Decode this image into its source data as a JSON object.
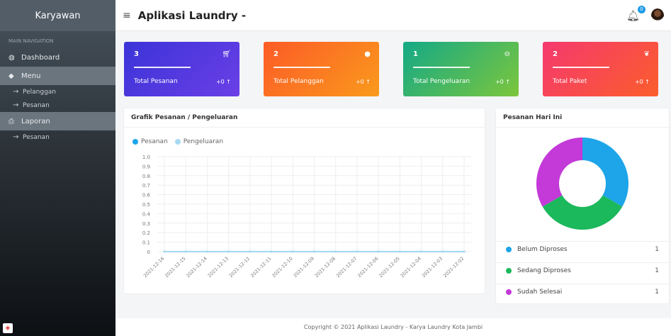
{
  "sidebar": {
    "brand": "Karyawan",
    "section": "MAIN NAVIGATION",
    "items": [
      {
        "label": "Dashboard"
      },
      {
        "label": "Menu"
      },
      {
        "label": "Pelanggan"
      },
      {
        "label": "Pesanan"
      },
      {
        "label": "Laporan"
      },
      {
        "label": "Pesanan"
      }
    ]
  },
  "header": {
    "menu_icon": "≡",
    "title": "Aplikasi Laundry -",
    "notif_count": "0"
  },
  "cards": [
    {
      "value": "3",
      "label": "Total Pesanan",
      "change": "+0 ↑",
      "icon": "cart-icon",
      "color": "#4f3fe0"
    },
    {
      "value": "2",
      "label": "Total Pelanggan",
      "change": "+0 ↑",
      "icon": "user-icon",
      "color": "#f77e21"
    },
    {
      "value": "1",
      "label": "Total Pengeluaran",
      "change": "+0 ↑",
      "icon": "arrow-circle-icon",
      "color": "#28b46b"
    },
    {
      "value": "2",
      "label": "Total Paket",
      "change": "+0 ↑",
      "icon": "leaf-icon",
      "color": "#f23d55"
    }
  ],
  "line_panel": {
    "title": "Grafik Pesanan / Pengeluaran"
  },
  "donut_panel": {
    "title": "Pesanan Hari Ini",
    "rows": [
      {
        "label": "Belum Diproses",
        "value": "1",
        "color": "#1ea5e9"
      },
      {
        "label": "Sedang Diproses",
        "value": "1",
        "color": "#1bb85c"
      },
      {
        "label": "Sudah Selesai",
        "value": "1",
        "color": "#c33ad8"
      }
    ]
  },
  "chart_data": [
    {
      "type": "line",
      "series": [
        {
          "name": "Pesanan",
          "values": [
            0,
            0,
            0,
            0,
            0,
            0,
            0,
            0,
            0,
            0,
            0,
            0,
            0,
            0,
            0
          ],
          "color": "#1ea5e9"
        },
        {
          "name": "Pengeluaran",
          "values": [
            0,
            0,
            0,
            0,
            0,
            0,
            0,
            0,
            0,
            0,
            0,
            0,
            0,
            0,
            0
          ],
          "color": "#a7daf2"
        }
      ],
      "x": [
        "2021-12-16",
        "2021-12-15",
        "2021-12-14",
        "2021-12-13",
        "2021-12-12",
        "2021-12-11",
        "2021-12-10",
        "2021-12-09",
        "2021-12-08",
        "2021-12-07",
        "2021-12-06",
        "2021-12-05",
        "2021-12-04",
        "2021-12-03",
        "2021-12-02"
      ],
      "y_ticks": [
        "1.0",
        "0.9",
        "0.8",
        "0.7",
        "0.6",
        "0.5",
        "0.4",
        "0.3",
        "0.2",
        "0.1",
        "0"
      ],
      "ylim": [
        0,
        1
      ],
      "grid": true,
      "legend": "top-left"
    },
    {
      "type": "pie",
      "categories": [
        "Belum Diproses",
        "Sedang Diproses",
        "Sudah Selesai"
      ],
      "values": [
        1,
        1,
        1
      ],
      "colors": [
        "#1ea5e9",
        "#1bb85c",
        "#c33ad8"
      ]
    }
  ],
  "footer": "Copyright © 2021 Aplikasi Laundry - Karya Laundry Kota Jambi"
}
